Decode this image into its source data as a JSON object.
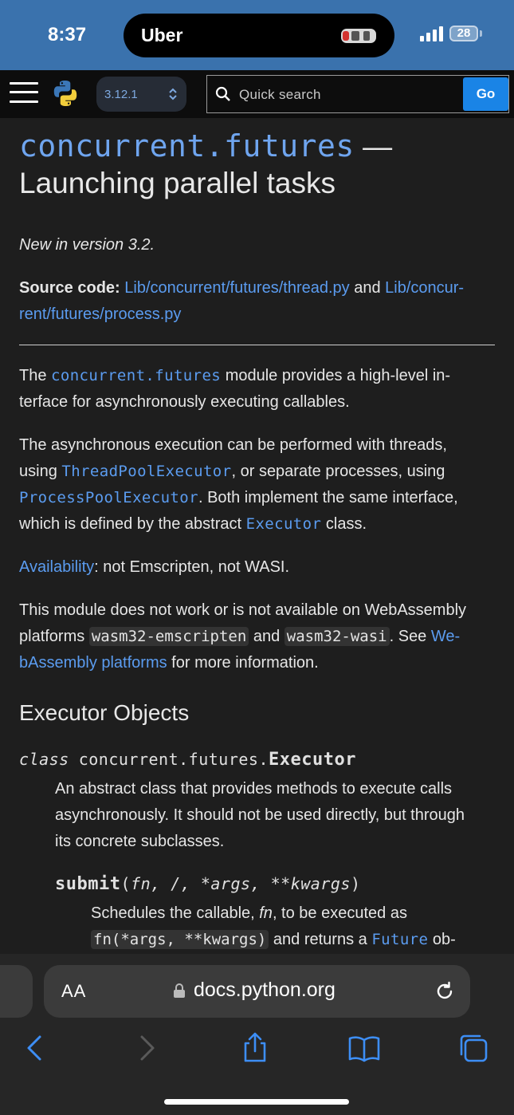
{
  "status_bar": {
    "time": "8:37",
    "island_app": "Uber",
    "battery": "28",
    "background": "#3a72ad"
  },
  "navbar": {
    "version": "3.12.1",
    "search_placeholder": "Quick search",
    "go_label": "Go",
    "go_color": "#1a84e6"
  },
  "page": {
    "title_module": "concurrent.futures",
    "title_dash": " —",
    "title_text": "Launching parallel tasks",
    "new_in_version": "New in version 3.2.",
    "source_label": "Source code:",
    "source_link1": "Lib/concurrent/futures/thread.py",
    "source_and": " and ",
    "source_link2a": "Lib/concur-",
    "source_link2b": "rent/futures/process.py",
    "p1_the": "The ",
    "p1_code": "concurrent.futures",
    "p1_rest_a": " module provides a high-level in-",
    "p1_rest_b": "terface for asynchronously executing callables.",
    "p2_a": "The asynchronous execution can be performed with threads,",
    "p2_using": "using ",
    "p2_code1": "ThreadPoolExecutor",
    "p2_b": ", or separate processes, using",
    "p2_code2": "ProcessPoolExecutor",
    "p2_c": ". Both implement the same interface,",
    "p2_d": "which is defined by the abstract ",
    "p2_code3": "Executor",
    "p2_e": " class.",
    "avail_link": "Availability",
    "avail_text": ": not Emscripten, not WASI.",
    "p3_a": "This module does not work or is not available on WebAssembly",
    "p3_b": "platforms ",
    "p3_code1": "wasm32-emscripten",
    "p3_and": " and ",
    "p3_code2": "wasm32-wasi",
    "p3_see": ". See ",
    "p3_link_a": "We-",
    "p3_link_b": "bAssembly platforms",
    "p3_end": " for more information.",
    "section_title": "Executor Objects",
    "executor_kw": "class",
    "executor_prefix": "concurrent.futures.",
    "executor_name": "Executor",
    "executor_desc_a": "An abstract class that provides methods to execute calls",
    "executor_desc_b": "asynchronously. It should not be used directly, but through",
    "executor_desc_c": "its concrete subclasses.",
    "submit_name": "submit",
    "submit_open": "(",
    "submit_params": "fn, /, *args, **kwargs",
    "submit_close": ")",
    "submit_desc_a": "Schedules the callable, ",
    "submit_desc_fn": "fn",
    "submit_desc_b": ", to be executed as",
    "submit_code": "fn(*args, **kwargs)",
    "submit_desc_c": " and returns a ",
    "submit_link": "Future",
    "submit_desc_d": " ob-"
  },
  "safari": {
    "aa": "AA",
    "domain": "docs.python.org"
  }
}
